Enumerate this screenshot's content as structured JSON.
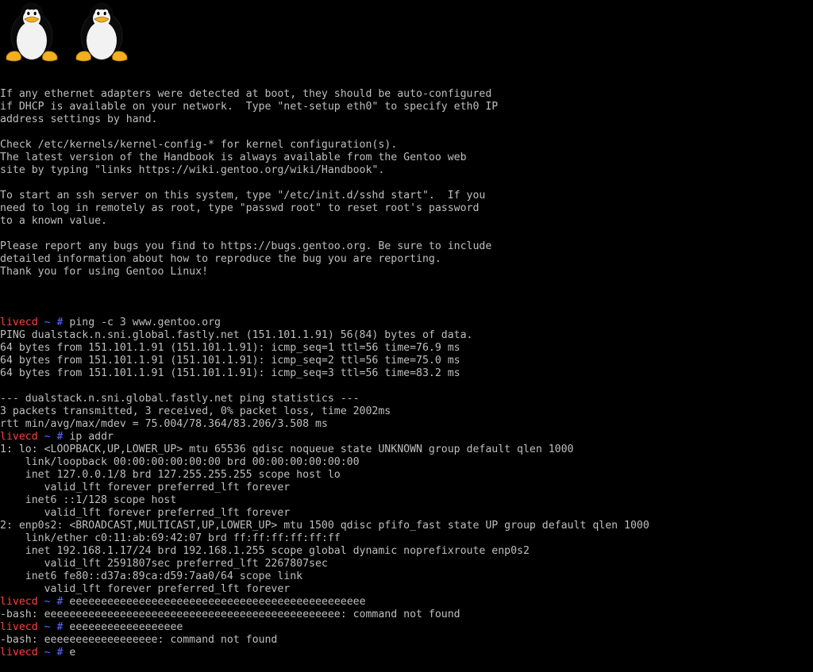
{
  "logo": {
    "icon": "tux-penguin-icon",
    "count": 2
  },
  "colors": {
    "background": "#000000",
    "text": "#bfbfbf",
    "prompt_host": "#ff4040",
    "prompt_path": "#5b6cff"
  },
  "prompt": {
    "host": "livecd",
    "path": "~",
    "symbol": "#"
  },
  "motd": [
    "If any ethernet adapters were detected at boot, they should be auto-configured",
    "if DHCP is available on your network.  Type \"net-setup eth0\" to specify eth0 IP",
    "address settings by hand.",
    "",
    "Check /etc/kernels/kernel-config-* for kernel configuration(s).",
    "The latest version of the Handbook is always available from the Gentoo web",
    "site by typing \"links https://wiki.gentoo.org/wiki/Handbook\".",
    "",
    "To start an ssh server on this system, type \"/etc/init.d/sshd start\".  If you",
    "need to log in remotely as root, type \"passwd root\" to reset root's password",
    "to a known value.",
    "",
    "Please report any bugs you find to https://bugs.gentoo.org. Be sure to include",
    "detailed information about how to reproduce the bug you are reporting.",
    "Thank you for using Gentoo Linux!",
    ""
  ],
  "session": [
    {
      "type": "prompt",
      "command": "ping -c 3 www.gentoo.org"
    },
    {
      "type": "output",
      "text": "PING dualstack.n.sni.global.fastly.net (151.101.1.91) 56(84) bytes of data."
    },
    {
      "type": "output",
      "text": "64 bytes from 151.101.1.91 (151.101.1.91): icmp_seq=1 ttl=56 time=76.9 ms"
    },
    {
      "type": "output",
      "text": "64 bytes from 151.101.1.91 (151.101.1.91): icmp_seq=2 ttl=56 time=75.0 ms"
    },
    {
      "type": "output",
      "text": "64 bytes from 151.101.1.91 (151.101.1.91): icmp_seq=3 ttl=56 time=83.2 ms"
    },
    {
      "type": "output",
      "text": ""
    },
    {
      "type": "output",
      "text": "--- dualstack.n.sni.global.fastly.net ping statistics ---"
    },
    {
      "type": "output",
      "text": "3 packets transmitted, 3 received, 0% packet loss, time 2002ms"
    },
    {
      "type": "output",
      "text": "rtt min/avg/max/mdev = 75.004/78.364/83.206/3.508 ms"
    },
    {
      "type": "prompt",
      "command": "ip addr"
    },
    {
      "type": "output",
      "text": "1: lo: <LOOPBACK,UP,LOWER_UP> mtu 65536 qdisc noqueue state UNKNOWN group default qlen 1000"
    },
    {
      "type": "output",
      "text": "    link/loopback 00:00:00:00:00:00 brd 00:00:00:00:00:00"
    },
    {
      "type": "output",
      "text": "    inet 127.0.0.1/8 brd 127.255.255.255 scope host lo"
    },
    {
      "type": "output",
      "text": "       valid_lft forever preferred_lft forever"
    },
    {
      "type": "output",
      "text": "    inet6 ::1/128 scope host"
    },
    {
      "type": "output",
      "text": "       valid_lft forever preferred_lft forever"
    },
    {
      "type": "output",
      "text": "2: enp0s2: <BROADCAST,MULTICAST,UP,LOWER_UP> mtu 1500 qdisc pfifo_fast state UP group default qlen 1000"
    },
    {
      "type": "output",
      "text": "    link/ether c0:11:ab:69:42:07 brd ff:ff:ff:ff:ff:ff"
    },
    {
      "type": "output",
      "text": "    inet 192.168.1.17/24 brd 192.168.1.255 scope global dynamic noprefixroute enp0s2"
    },
    {
      "type": "output",
      "text": "       valid_lft 2591807sec preferred_lft 2267807sec"
    },
    {
      "type": "output",
      "text": "    inet6 fe80::d37a:89ca:d59:7aa0/64 scope link"
    },
    {
      "type": "output",
      "text": "       valid_lft forever preferred_lft forever"
    },
    {
      "type": "prompt",
      "command": "eeeeeeeeeeeeeeeeeeeeeeeeeeeeeeeeeeeeeeeeeeeeeee"
    },
    {
      "type": "output",
      "text": "-bash: eeeeeeeeeeeeeeeeeeeeeeeeeeeeeeeeeeeeeeeeeeeeeee: command not found"
    },
    {
      "type": "prompt",
      "command": "eeeeeeeeeeeeeeeeee"
    },
    {
      "type": "output",
      "text": "-bash: eeeeeeeeeeeeeeeeee: command not found"
    },
    {
      "type": "prompt",
      "command": "e",
      "current": true
    }
  ]
}
